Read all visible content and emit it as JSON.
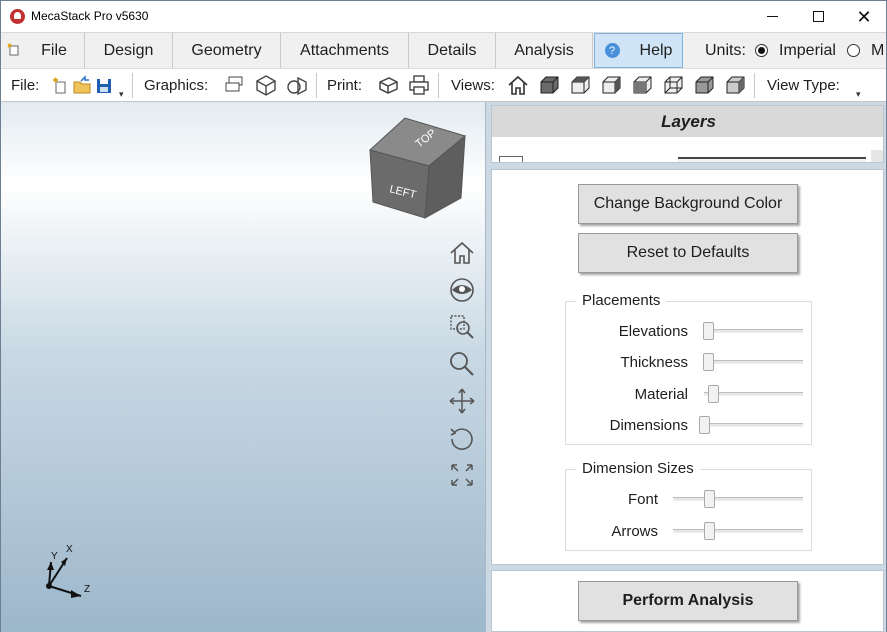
{
  "window": {
    "title": "MecaStack Pro v5630",
    "minimize": "",
    "maximize": "",
    "close": "✕"
  },
  "menu": {
    "tabs": [
      {
        "label": "File"
      },
      {
        "label": "Design"
      },
      {
        "label": "Geometry"
      },
      {
        "label": "Attachments"
      },
      {
        "label": "Details"
      },
      {
        "label": "Analysis"
      },
      {
        "label": "Help"
      }
    ],
    "help_icon": "?",
    "units_label": "Units:",
    "units_options": [
      {
        "label": "Imperial",
        "selected": true
      },
      {
        "label": "M",
        "selected": false
      }
    ]
  },
  "toolbar": {
    "file_label": "File:",
    "graphics_label": "Graphics:",
    "print_label": "Print:",
    "views_label": "Views:",
    "view_type_label": "View Type:",
    "dropdown_glyph": "▾"
  },
  "viewport": {
    "cube_faces": {
      "top": "TOP",
      "left": "LEFT"
    },
    "triad": {
      "x": "X",
      "y": "Y",
      "z": "Z"
    },
    "icons": [
      "home-icon",
      "eye-icon",
      "zoom-window-icon",
      "zoom-icon",
      "pan-icon",
      "rotate-icon",
      "fit-all-icon"
    ]
  },
  "layers": {
    "title": "Layers"
  },
  "settings": {
    "change_bg_button": "Change Background Color",
    "reset_button": "Reset to Defaults",
    "placements": {
      "title": "Placements",
      "sliders": [
        {
          "label": "Elevations",
          "value": 0.0
        },
        {
          "label": "Thickness",
          "value": 0.0
        },
        {
          "label": "Material",
          "value": 0.06
        },
        {
          "label": "Dimensions",
          "value": 0.0
        }
      ]
    },
    "dimension_sizes": {
      "title": "Dimension Sizes",
      "sliders": [
        {
          "label": "Font",
          "value": 0.25
        },
        {
          "label": "Arrows",
          "value": 0.25
        }
      ]
    }
  },
  "analysis": {
    "perform_button": "Perform Analysis"
  },
  "colors": {
    "accent_tab": "#cfe4f6",
    "viewport_bottom": "#9db7cb",
    "panel_bg": "#cdd9e2"
  }
}
